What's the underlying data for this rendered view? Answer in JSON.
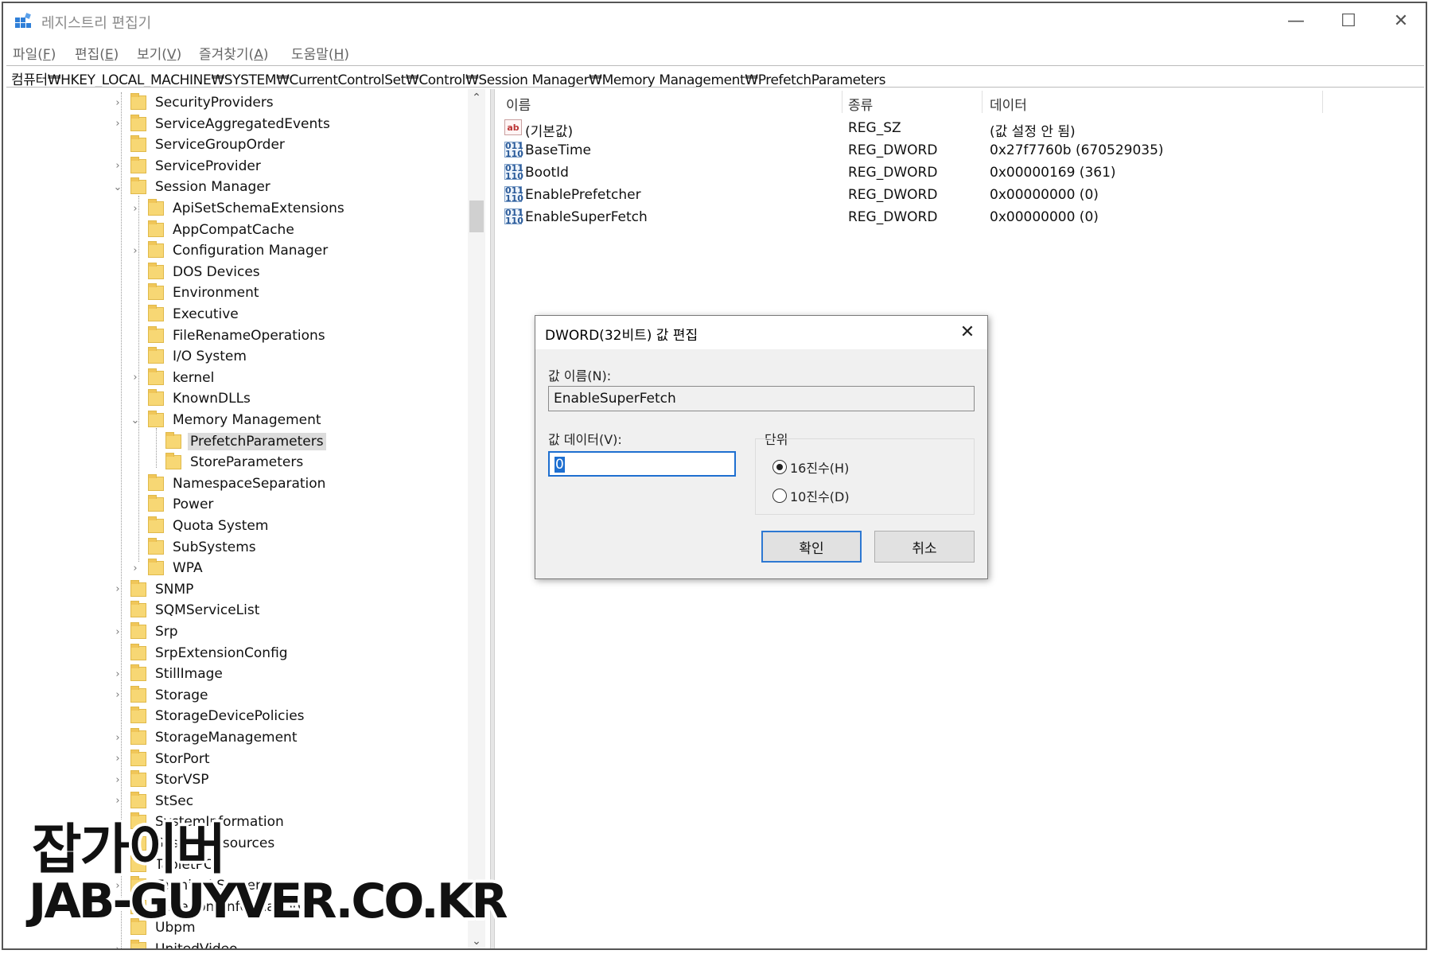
{
  "window": {
    "title": "레지스트리 편집기",
    "minimize": "—",
    "maximize": "☐",
    "close": "✕"
  },
  "menu": [
    {
      "label": "파일(",
      "key": "F",
      "end": ")"
    },
    {
      "label": "편집(",
      "key": "E",
      "end": ")"
    },
    {
      "label": "보기(",
      "key": "V",
      "end": ")"
    },
    {
      "label": "즐겨찾기(",
      "key": "A",
      "end": ")"
    },
    {
      "label": "도움말(",
      "key": "H",
      "end": ")"
    }
  ],
  "address": "컴퓨터₩HKEY_LOCAL_MACHINE₩SYSTEM₩CurrentControlSet₩Control₩Session Manager₩Memory Management₩PrefetchParameters",
  "tree": [
    {
      "label": "SecurityProviders",
      "level": 0,
      "exp": "›"
    },
    {
      "label": "ServiceAggregatedEvents",
      "level": 0,
      "exp": "›"
    },
    {
      "label": "ServiceGroupOrder",
      "level": 0,
      "exp": ""
    },
    {
      "label": "ServiceProvider",
      "level": 0,
      "exp": "›"
    },
    {
      "label": "Session Manager",
      "level": 0,
      "exp": "⌄"
    },
    {
      "label": "ApiSetSchemaExtensions",
      "level": 1,
      "exp": "›"
    },
    {
      "label": "AppCompatCache",
      "level": 1,
      "exp": ""
    },
    {
      "label": "Configuration Manager",
      "level": 1,
      "exp": "›"
    },
    {
      "label": "DOS Devices",
      "level": 1,
      "exp": ""
    },
    {
      "label": "Environment",
      "level": 1,
      "exp": ""
    },
    {
      "label": "Executive",
      "level": 1,
      "exp": ""
    },
    {
      "label": "FileRenameOperations",
      "level": 1,
      "exp": ""
    },
    {
      "label": "I/O System",
      "level": 1,
      "exp": ""
    },
    {
      "label": "kernel",
      "level": 1,
      "exp": "›"
    },
    {
      "label": "KnownDLLs",
      "level": 1,
      "exp": ""
    },
    {
      "label": "Memory Management",
      "level": 1,
      "exp": "⌄"
    },
    {
      "label": "PrefetchParameters",
      "level": 2,
      "exp": "",
      "selected": true
    },
    {
      "label": "StoreParameters",
      "level": 2,
      "exp": ""
    },
    {
      "label": "NamespaceSeparation",
      "level": 1,
      "exp": ""
    },
    {
      "label": "Power",
      "level": 1,
      "exp": ""
    },
    {
      "label": "Quota System",
      "level": 1,
      "exp": ""
    },
    {
      "label": "SubSystems",
      "level": 1,
      "exp": ""
    },
    {
      "label": "WPA",
      "level": 1,
      "exp": "›"
    },
    {
      "label": "SNMP",
      "level": 0,
      "exp": "›"
    },
    {
      "label": "SQMServiceList",
      "level": 0,
      "exp": ""
    },
    {
      "label": "Srp",
      "level": 0,
      "exp": "›"
    },
    {
      "label": "SrpExtensionConfig",
      "level": 0,
      "exp": ""
    },
    {
      "label": "StillImage",
      "level": 0,
      "exp": "›"
    },
    {
      "label": "Storage",
      "level": 0,
      "exp": "›"
    },
    {
      "label": "StorageDevicePolicies",
      "level": 0,
      "exp": ""
    },
    {
      "label": "StorageManagement",
      "level": 0,
      "exp": "›"
    },
    {
      "label": "StorPort",
      "level": 0,
      "exp": "›"
    },
    {
      "label": "StorVSP",
      "level": 0,
      "exp": "›"
    },
    {
      "label": "StSec",
      "level": 0,
      "exp": "›"
    },
    {
      "label": "SystemInformation",
      "level": 0,
      "exp": ""
    },
    {
      "label": "SystemResources",
      "level": 0,
      "exp": "›"
    },
    {
      "label": "TabletPC",
      "level": 0,
      "exp": "›"
    },
    {
      "label": "Terminal Server",
      "level": 0,
      "exp": "›"
    },
    {
      "label": "TimeZoneInformation",
      "level": 0,
      "exp": ""
    },
    {
      "label": "Ubpm",
      "level": 0,
      "exp": ""
    },
    {
      "label": "UnitedVideo",
      "level": 0,
      "exp": "›"
    }
  ],
  "list": {
    "headers": {
      "name": "이름",
      "type": "종류",
      "data": "데이터"
    },
    "rows": [
      {
        "icon": "ab",
        "name": "(기본값)",
        "type": "REG_SZ",
        "data": "(값 설정 안 됨)"
      },
      {
        "icon": "dword",
        "name": "BaseTime",
        "type": "REG_DWORD",
        "data": "0x27f7760b (670529035)"
      },
      {
        "icon": "dword",
        "name": "BootId",
        "type": "REG_DWORD",
        "data": "0x00000169 (361)"
      },
      {
        "icon": "dword",
        "name": "EnablePrefetcher",
        "type": "REG_DWORD",
        "data": "0x00000000 (0)"
      },
      {
        "icon": "dword",
        "name": "EnableSuperFetch",
        "type": "REG_DWORD",
        "data": "0x00000000 (0)"
      }
    ]
  },
  "dialog": {
    "title": "DWORD(32비트) 값 편집",
    "name_label": "값 이름(N):",
    "name_value": "EnableSuperFetch",
    "data_label": "값 데이터(V):",
    "data_value": "0",
    "base_label": "단위",
    "hex_label": "16진수(H)",
    "dec_label": "10진수(D)",
    "ok": "확인",
    "cancel": "취소"
  },
  "watermark": {
    "line1": "잡가이버",
    "line2": "JAB-GUYVER.CO.KR"
  }
}
